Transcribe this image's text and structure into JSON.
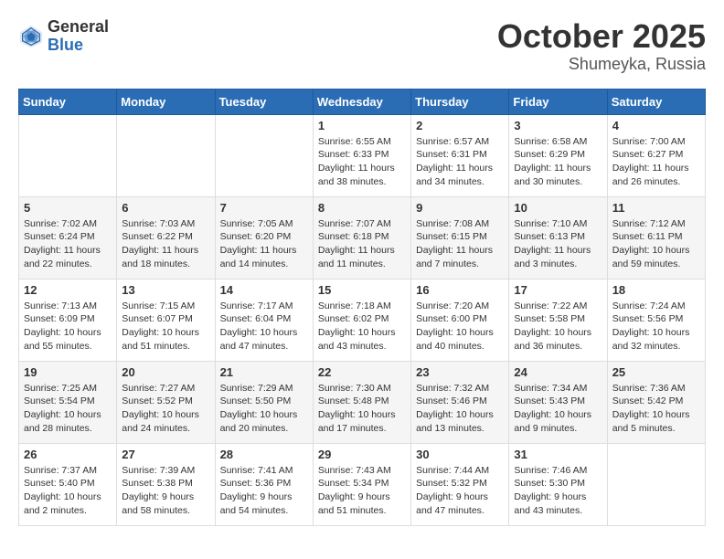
{
  "header": {
    "logo_general": "General",
    "logo_blue": "Blue",
    "month": "October 2025",
    "location": "Shumeyka, Russia"
  },
  "days_of_week": [
    "Sunday",
    "Monday",
    "Tuesday",
    "Wednesday",
    "Thursday",
    "Friday",
    "Saturday"
  ],
  "weeks": [
    [
      {
        "num": "",
        "info": ""
      },
      {
        "num": "",
        "info": ""
      },
      {
        "num": "",
        "info": ""
      },
      {
        "num": "1",
        "info": "Sunrise: 6:55 AM\nSunset: 6:33 PM\nDaylight: 11 hours\nand 38 minutes."
      },
      {
        "num": "2",
        "info": "Sunrise: 6:57 AM\nSunset: 6:31 PM\nDaylight: 11 hours\nand 34 minutes."
      },
      {
        "num": "3",
        "info": "Sunrise: 6:58 AM\nSunset: 6:29 PM\nDaylight: 11 hours\nand 30 minutes."
      },
      {
        "num": "4",
        "info": "Sunrise: 7:00 AM\nSunset: 6:27 PM\nDaylight: 11 hours\nand 26 minutes."
      }
    ],
    [
      {
        "num": "5",
        "info": "Sunrise: 7:02 AM\nSunset: 6:24 PM\nDaylight: 11 hours\nand 22 minutes."
      },
      {
        "num": "6",
        "info": "Sunrise: 7:03 AM\nSunset: 6:22 PM\nDaylight: 11 hours\nand 18 minutes."
      },
      {
        "num": "7",
        "info": "Sunrise: 7:05 AM\nSunset: 6:20 PM\nDaylight: 11 hours\nand 14 minutes."
      },
      {
        "num": "8",
        "info": "Sunrise: 7:07 AM\nSunset: 6:18 PM\nDaylight: 11 hours\nand 11 minutes."
      },
      {
        "num": "9",
        "info": "Sunrise: 7:08 AM\nSunset: 6:15 PM\nDaylight: 11 hours\nand 7 minutes."
      },
      {
        "num": "10",
        "info": "Sunrise: 7:10 AM\nSunset: 6:13 PM\nDaylight: 11 hours\nand 3 minutes."
      },
      {
        "num": "11",
        "info": "Sunrise: 7:12 AM\nSunset: 6:11 PM\nDaylight: 10 hours\nand 59 minutes."
      }
    ],
    [
      {
        "num": "12",
        "info": "Sunrise: 7:13 AM\nSunset: 6:09 PM\nDaylight: 10 hours\nand 55 minutes."
      },
      {
        "num": "13",
        "info": "Sunrise: 7:15 AM\nSunset: 6:07 PM\nDaylight: 10 hours\nand 51 minutes."
      },
      {
        "num": "14",
        "info": "Sunrise: 7:17 AM\nSunset: 6:04 PM\nDaylight: 10 hours\nand 47 minutes."
      },
      {
        "num": "15",
        "info": "Sunrise: 7:18 AM\nSunset: 6:02 PM\nDaylight: 10 hours\nand 43 minutes."
      },
      {
        "num": "16",
        "info": "Sunrise: 7:20 AM\nSunset: 6:00 PM\nDaylight: 10 hours\nand 40 minutes."
      },
      {
        "num": "17",
        "info": "Sunrise: 7:22 AM\nSunset: 5:58 PM\nDaylight: 10 hours\nand 36 minutes."
      },
      {
        "num": "18",
        "info": "Sunrise: 7:24 AM\nSunset: 5:56 PM\nDaylight: 10 hours\nand 32 minutes."
      }
    ],
    [
      {
        "num": "19",
        "info": "Sunrise: 7:25 AM\nSunset: 5:54 PM\nDaylight: 10 hours\nand 28 minutes."
      },
      {
        "num": "20",
        "info": "Sunrise: 7:27 AM\nSunset: 5:52 PM\nDaylight: 10 hours\nand 24 minutes."
      },
      {
        "num": "21",
        "info": "Sunrise: 7:29 AM\nSunset: 5:50 PM\nDaylight: 10 hours\nand 20 minutes."
      },
      {
        "num": "22",
        "info": "Sunrise: 7:30 AM\nSunset: 5:48 PM\nDaylight: 10 hours\nand 17 minutes."
      },
      {
        "num": "23",
        "info": "Sunrise: 7:32 AM\nSunset: 5:46 PM\nDaylight: 10 hours\nand 13 minutes."
      },
      {
        "num": "24",
        "info": "Sunrise: 7:34 AM\nSunset: 5:43 PM\nDaylight: 10 hours\nand 9 minutes."
      },
      {
        "num": "25",
        "info": "Sunrise: 7:36 AM\nSunset: 5:42 PM\nDaylight: 10 hours\nand 5 minutes."
      }
    ],
    [
      {
        "num": "26",
        "info": "Sunrise: 7:37 AM\nSunset: 5:40 PM\nDaylight: 10 hours\nand 2 minutes."
      },
      {
        "num": "27",
        "info": "Sunrise: 7:39 AM\nSunset: 5:38 PM\nDaylight: 9 hours\nand 58 minutes."
      },
      {
        "num": "28",
        "info": "Sunrise: 7:41 AM\nSunset: 5:36 PM\nDaylight: 9 hours\nand 54 minutes."
      },
      {
        "num": "29",
        "info": "Sunrise: 7:43 AM\nSunset: 5:34 PM\nDaylight: 9 hours\nand 51 minutes."
      },
      {
        "num": "30",
        "info": "Sunrise: 7:44 AM\nSunset: 5:32 PM\nDaylight: 9 hours\nand 47 minutes."
      },
      {
        "num": "31",
        "info": "Sunrise: 7:46 AM\nSunset: 5:30 PM\nDaylight: 9 hours\nand 43 minutes."
      },
      {
        "num": "",
        "info": ""
      }
    ]
  ]
}
